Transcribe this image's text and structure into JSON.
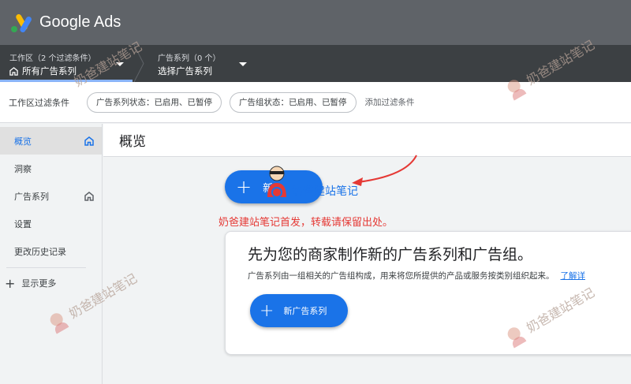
{
  "app": {
    "brand": "Google Ads"
  },
  "scope": {
    "workspace_label": "工作区（2 个过滤条件）",
    "workspace_value": "所有广告系列",
    "campaign_label": "广告系列（0 个）",
    "campaign_value": "选择广告系列"
  },
  "filters": {
    "title": "工作区过滤条件",
    "chips": [
      "广告系列状态：已启用、已暂停",
      "广告组状态：已启用、已暂停"
    ],
    "add": "添加过滤条件"
  },
  "sidebar": {
    "items": [
      {
        "label": "概览",
        "active": true,
        "icon": "home-icon"
      },
      {
        "label": "洞察",
        "active": false
      },
      {
        "label": "广告系列",
        "active": false,
        "icon": "home-icon"
      },
      {
        "label": "设置",
        "active": false
      },
      {
        "label": "更改历史记录",
        "active": false
      }
    ],
    "show_more": "显示更多"
  },
  "main": {
    "title": "概览",
    "fab_label": "新",
    "note": "奶爸建站笔记首发，转载请保留出处。",
    "card": {
      "title": "先为您的商家制作新的广告系列和广告组。",
      "desc": "广告系列由一组相关的广告组构成，用来将您所提供的产品或服务按类别组织起来。",
      "link": "了解详",
      "button": "新广告系列"
    }
  },
  "watermark": {
    "text": "奶爸建站笔记"
  },
  "colors": {
    "primary": "#1a73e8",
    "topbar": "#5f6368",
    "scopebar": "#3c4043",
    "note": "#e53935"
  }
}
